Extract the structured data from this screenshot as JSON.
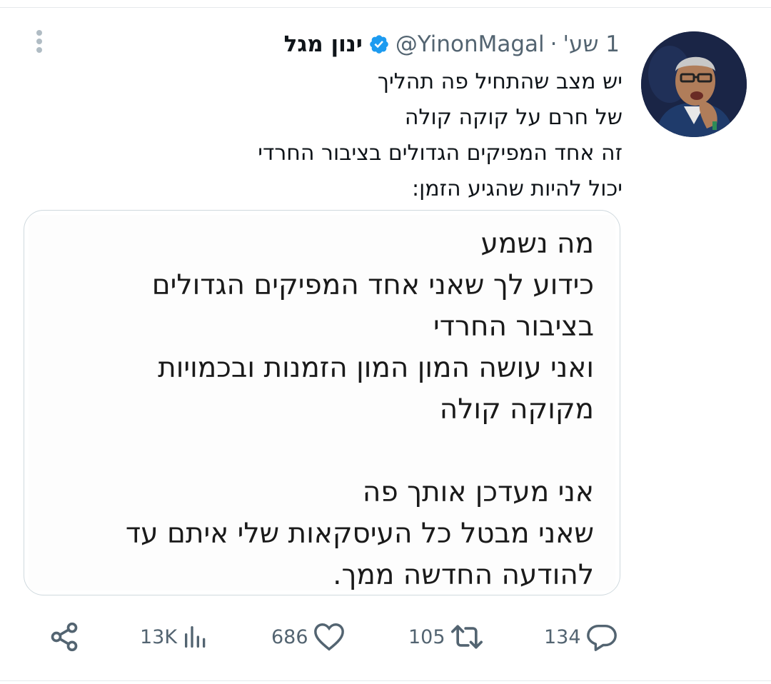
{
  "tweet": {
    "author": {
      "display_name": "ינון מגל",
      "handle": "@YinonMagal",
      "verified": true
    },
    "separator": "·",
    "time": "1 שע'",
    "text_lines": [
      "יש מצב שהתחיל פה תהליך",
      "של חרם על קוקה קולה",
      "זה אחד המפיקים הגדולים בציבור החרדי",
      "יכול להיות שהגיע הזמן:"
    ],
    "media_text_lines": [
      "מה נשמע",
      "כידוע לך שאני אחד המפיקים הגדולים",
      "בציבור החרדי",
      "ואני עושה המון המון הזמנות ובכמויות",
      "מקוקה קולה",
      "",
      "אני מעדכן אותך פה",
      "שאני מבטל כל העיסקאות שלי איתם עד",
      "להודעה החדשה ממך."
    ],
    "stats": {
      "replies": "134",
      "retweets": "105",
      "likes": "686",
      "views": "13K"
    }
  },
  "colors": {
    "verified": "#1d9bf0",
    "secondary_text": "#536471",
    "divider": "#e6e9ec"
  },
  "icons": {
    "more": "vertical-ellipsis-icon",
    "verified": "verified-badge-icon",
    "reply": "reply-bubble-icon",
    "retweet": "retweet-icon",
    "like": "heart-icon",
    "views": "bar-chart-icon",
    "share": "share-icon"
  }
}
